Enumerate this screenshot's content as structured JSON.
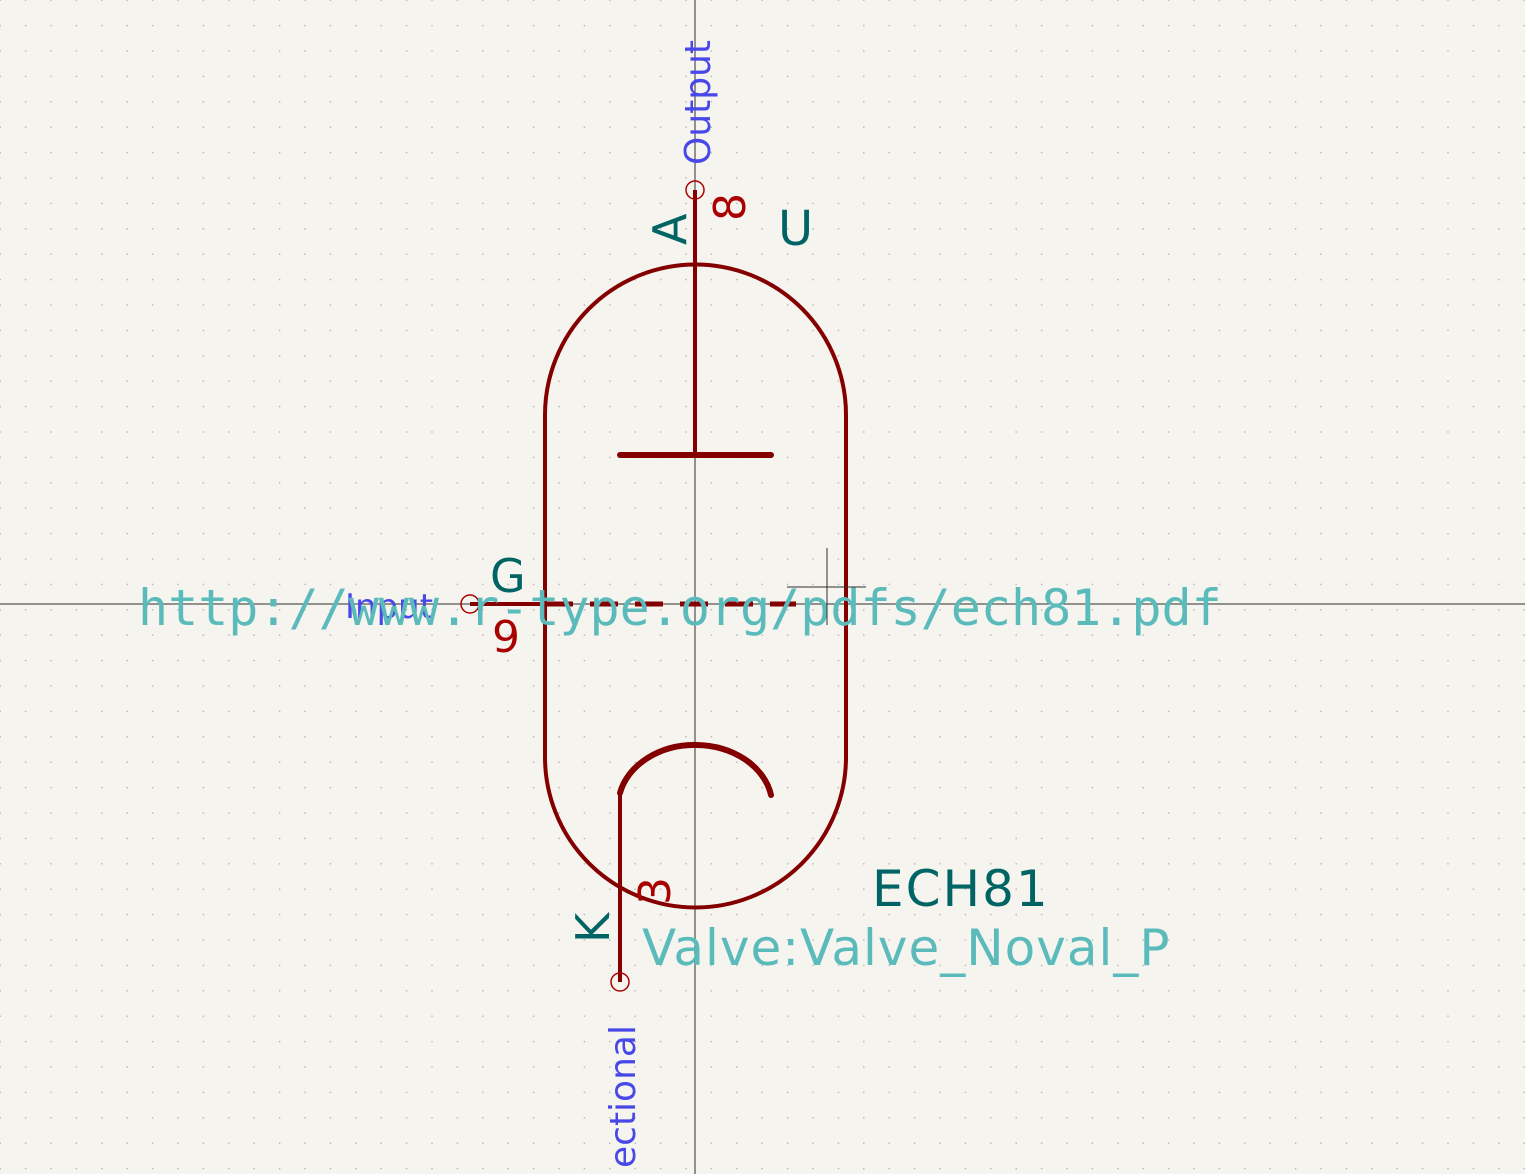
{
  "symbol": {
    "reference_suffix": "U",
    "value": "ECH81",
    "footprint": "Valve:Valve_Noval_P",
    "datasheet": "http://www.r-type.org/pdfs/ech81.pdf"
  },
  "pins": {
    "anode": {
      "name": "A",
      "number": "8",
      "type": "Output"
    },
    "grid": {
      "name": "G",
      "number": "9",
      "type": "Input"
    },
    "cathode": {
      "name": "K",
      "number": "3",
      "type": "ectional"
    }
  },
  "colors": {
    "background": "#f5f4ef",
    "grid_dot": "#b4b4b4",
    "body": "#840000",
    "pin_name": "#006464",
    "pin_number": "#a90000",
    "field": "#5bbbbb",
    "pin_type": "#4848e8",
    "crosshair": "#2e2e2e"
  }
}
